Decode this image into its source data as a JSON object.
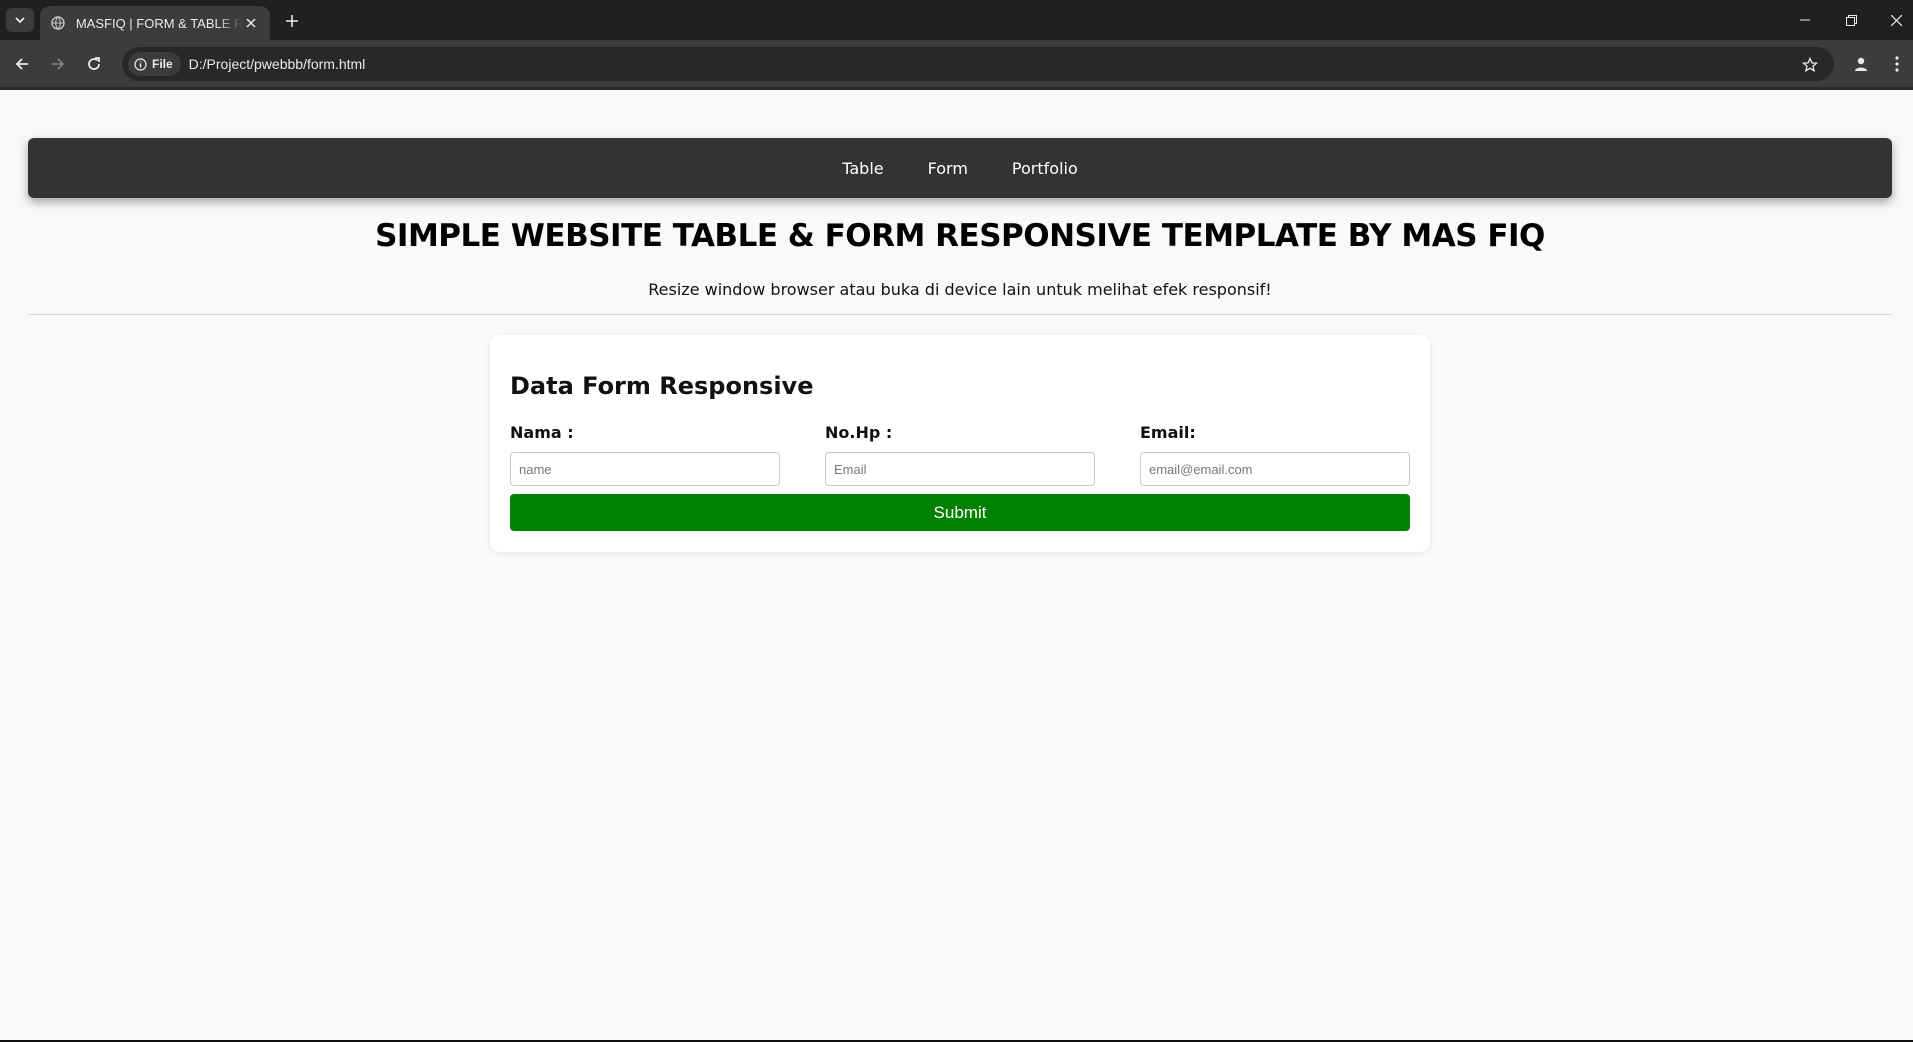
{
  "browser": {
    "tab_title": "MASFIQ | FORM & TABLE RESPONSIVE",
    "url_chip": "File",
    "url": "D:/Project/pwebbb/form.html"
  },
  "nav": {
    "items": [
      {
        "label": "Table"
      },
      {
        "label": "Form"
      },
      {
        "label": "Portfolio"
      }
    ]
  },
  "header": {
    "title": "SIMPLE WEBSITE TABLE & FORM RESPONSIVE TEMPLATE BY MAS FIQ",
    "subtitle": "Resize window browser atau buka di device lain untuk melihat efek responsif!"
  },
  "form": {
    "title": "Data Form Responsive",
    "fields": [
      {
        "label": "Nama :",
        "placeholder": "name",
        "value": ""
      },
      {
        "label": "No.Hp :",
        "placeholder": "Email",
        "value": ""
      },
      {
        "label": "Email:",
        "placeholder": "email@email.com",
        "value": ""
      }
    ],
    "submit_label": "Submit"
  },
  "colors": {
    "navbar_bg": "#333333",
    "submit_bg": "#008000",
    "page_bg": "#f8f9fa"
  },
  "icons": [
    "tab-search-icon",
    "globe-icon",
    "close-icon",
    "plus-icon",
    "minimize-icon",
    "restore-icon",
    "window-close-icon",
    "back-icon",
    "forward-icon",
    "reload-icon",
    "info-icon",
    "star-icon",
    "profile-icon",
    "kebab-menu-icon"
  ]
}
